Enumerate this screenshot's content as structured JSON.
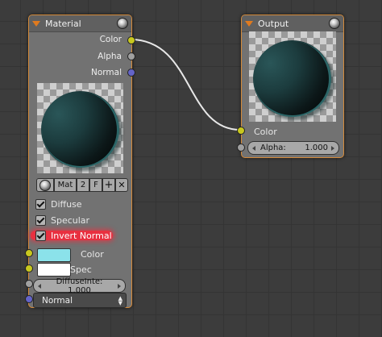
{
  "material_node": {
    "title": "Material",
    "outputs": [
      "Color",
      "Alpha",
      "Normal"
    ],
    "toolbar": {
      "datablock": "Mat",
      "users": "2",
      "fake": "F"
    },
    "diffuse_label": "Diffuse",
    "specular_label": "Specular",
    "invert_normal_label": "Invert Normal",
    "color_label": "Color",
    "color_value": "#8be2ea",
    "spec_label": "Spec",
    "spec_value": "#ffffff",
    "diffuse_intensity": "DiffuseInte: 1.000",
    "normal_dropdown": "Normal"
  },
  "output_node": {
    "title": "Output",
    "color_label": "Color",
    "alpha_field": "Alpha:",
    "alpha_value": "1.000"
  },
  "colors": {
    "header_accent": "#e07a1e",
    "socket_yellow": "#c8c81e",
    "socket_grey": "#a0a0a0",
    "socket_blue": "#6464c8",
    "highlight_red": "#e83040"
  }
}
